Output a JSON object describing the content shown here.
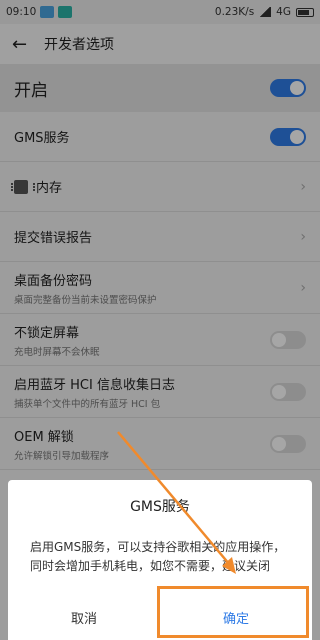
{
  "status": {
    "time": "09:10",
    "network": "0.23K/s",
    "carrier": "4G"
  },
  "toolbar": {
    "back": "←",
    "title": "开发者选项"
  },
  "master": {
    "label": "开启",
    "on": true
  },
  "rows": [
    {
      "title": "GMS服务",
      "type": "toggle",
      "on": true
    },
    {
      "title": "内存",
      "type": "chevron",
      "icon": "memory-chip-icon"
    },
    {
      "title": "提交错误报告",
      "type": "chevron"
    },
    {
      "title": "桌面备份密码",
      "subtitle": "桌面完整备份当前未设置密码保护",
      "type": "chevron"
    },
    {
      "title": "不锁定屏幕",
      "subtitle": "充电时屏幕不会休眠",
      "type": "toggle",
      "on": false
    },
    {
      "title": "启用蓝牙 HCI 信息收集日志",
      "subtitle": "捕获单个文件中的所有蓝牙 HCI 包",
      "type": "toggle",
      "on": false
    },
    {
      "title": "OEM 解锁",
      "subtitle": "允许解锁引导加载程序",
      "type": "toggle",
      "on": false
    }
  ],
  "dialog": {
    "title": "GMS服务",
    "message": "启用GMS服务，可以支持谷歌相关的应用操作，同时会增加手机耗电，如您不需要，建议关闭",
    "cancel": "取消",
    "ok": "确定"
  },
  "colors": {
    "accent": "#2f7be6",
    "highlight": "#f08a2c"
  }
}
